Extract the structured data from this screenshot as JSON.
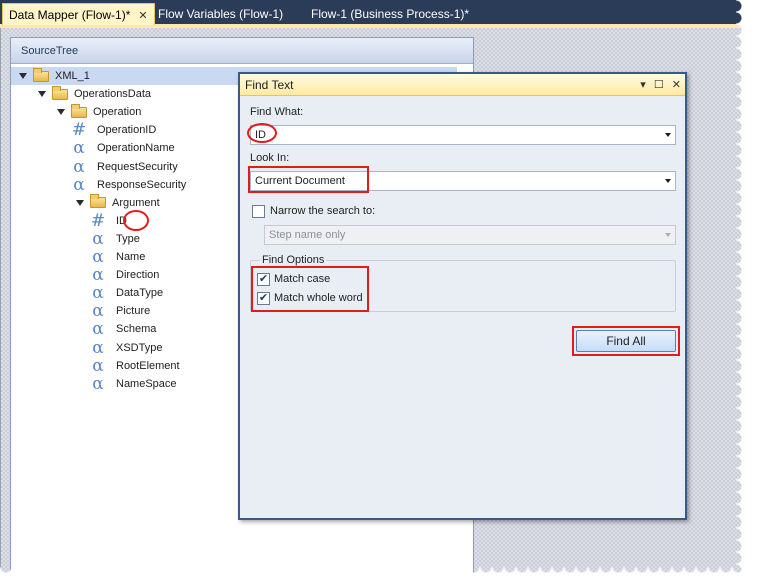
{
  "tabs": [
    {
      "label": "Data Mapper (Flow-1)*",
      "active": true,
      "close": "✕"
    },
    {
      "label": "Flow Variables (Flow-1)",
      "active": false
    },
    {
      "label": "Flow-1 (Business Process-1)*",
      "active": false
    }
  ],
  "source_tree": {
    "title": "SourceTree",
    "items": [
      {
        "label": "XML_1",
        "kind": "folder",
        "expanded": true,
        "depth": 0
      },
      {
        "label": "OperationsData",
        "kind": "folder",
        "expanded": true,
        "depth": 1
      },
      {
        "label": "Operation",
        "kind": "folder",
        "expanded": true,
        "depth": 2
      },
      {
        "label": "OperationID",
        "kind": "number",
        "icon": "#",
        "depth": 3
      },
      {
        "label": "OperationName",
        "kind": "string",
        "icon": "α",
        "depth": 3
      },
      {
        "label": "RequestSecurity",
        "kind": "string",
        "icon": "α",
        "depth": 3
      },
      {
        "label": "ResponseSecurity",
        "kind": "string",
        "icon": "α",
        "depth": 3
      },
      {
        "label": "Argument",
        "kind": "folder",
        "expanded": true,
        "depth": 3
      },
      {
        "label": "ID",
        "kind": "number",
        "icon": "#",
        "depth": 4,
        "highlighted": true
      },
      {
        "label": "Type",
        "kind": "string",
        "icon": "α",
        "depth": 4
      },
      {
        "label": "Name",
        "kind": "string",
        "icon": "α",
        "depth": 4
      },
      {
        "label": "Direction",
        "kind": "string",
        "icon": "α",
        "depth": 4
      },
      {
        "label": "DataType",
        "kind": "string",
        "icon": "α",
        "depth": 4
      },
      {
        "label": "Picture",
        "kind": "string",
        "icon": "α",
        "depth": 4
      },
      {
        "label": "Schema",
        "kind": "string",
        "icon": "α",
        "depth": 4
      },
      {
        "label": "XSDType",
        "kind": "string",
        "icon": "α",
        "depth": 4
      },
      {
        "label": "RootElement",
        "kind": "string",
        "icon": "α",
        "depth": 4
      },
      {
        "label": "NameSpace",
        "kind": "string",
        "icon": "α",
        "depth": 4
      }
    ]
  },
  "find_dialog": {
    "title": "Find Text",
    "controls": {
      "dropdown": "▾",
      "maximize": "☐",
      "close": "✕"
    },
    "find_what_label": "Find What:",
    "find_what_value": "ID",
    "look_in_label": "Look In:",
    "look_in_value": "Current Document",
    "narrow_label": "Narrow the search to:",
    "narrow_checked": false,
    "narrow_value": "Step name only",
    "find_options_label": "Find Options",
    "match_case_label": "Match case",
    "match_case_checked": true,
    "match_whole_word_label": "Match whole word",
    "match_whole_word_checked": true,
    "find_all_label": "Find All"
  },
  "colors": {
    "tab_strip": "#2b3c59",
    "active_tab": "#fff5c8",
    "annotation_red": "#e21b1b",
    "icon_blue": "#5b86c4"
  }
}
